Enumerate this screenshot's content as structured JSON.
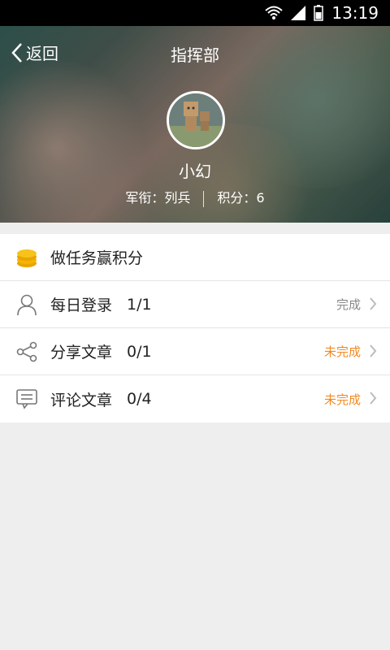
{
  "status_bar": {
    "time": "13:19"
  },
  "header": {
    "back_label": "返回",
    "title": "指挥部"
  },
  "profile": {
    "name": "小幻",
    "rank_label": "军衔：列兵",
    "points_label": "积分：6"
  },
  "section": {
    "title": "做任务赢积分"
  },
  "tasks": [
    {
      "label": "每日登录",
      "count": "1/1",
      "status": "完成",
      "icon": "person-icon"
    },
    {
      "label": "分享文章",
      "count": "0/1",
      "status": "未完成",
      "icon": "share-icon"
    },
    {
      "label": "评论文章",
      "count": "0/4",
      "status": "未完成",
      "icon": "comment-icon"
    }
  ],
  "colors": {
    "accent": "#f08a24",
    "done": "#888888",
    "coin": "#f5b400"
  }
}
